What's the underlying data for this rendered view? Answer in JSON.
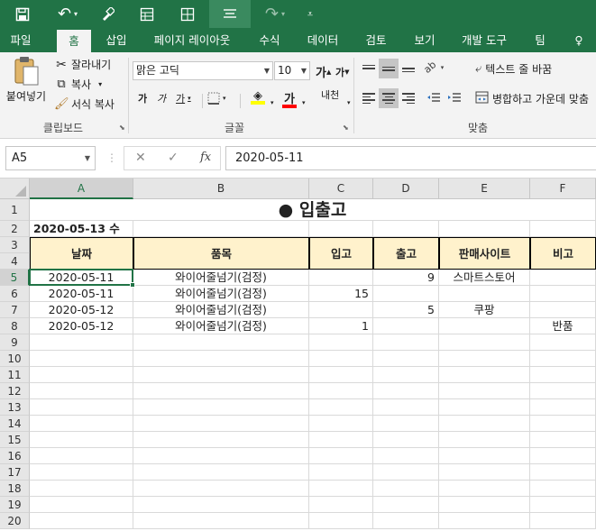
{
  "qat": {
    "save_icon": "save-icon",
    "undo_icon": "undo-icon",
    "brush_icon": "format-painter-icon",
    "form_icon": "form-icon",
    "table_icon": "borders-icon",
    "align_icon": "align-icon",
    "redo_icon": "redo-icon",
    "customize_icon": "customize-qat-icon",
    "undo_glyph": "↶",
    "redo_glyph": "↷",
    "dropdown_glyph": "▾",
    "customize_glyph": "⩡"
  },
  "tabs": [
    "파일",
    "홈",
    "삽입",
    "페이지 레이아웃",
    "수식",
    "데이터",
    "검토",
    "보기",
    "개발 도구",
    "팀"
  ],
  "tell_me_glyph": "♀",
  "ribbon": {
    "clipboard": {
      "paste_label": "붙여넣기",
      "cut_label": "잘라내기",
      "copy_label": "복사",
      "format_painter_label": "서식 복사",
      "group_label": "클립보드"
    },
    "font": {
      "font_name": "맑은 고딕",
      "font_size": "10",
      "grow_label": "가",
      "shrink_label": "가",
      "bold_label": "가",
      "italic_label": "가",
      "underline_label": "가",
      "font_color_label": "가",
      "phonetic_label": "내천",
      "group_label": "글꼴"
    },
    "alignment": {
      "wrap_text_label": "텍스트 줄 바꿈",
      "merge_center_label": "병합하고 가운데 맞춤",
      "group_label": "맞춤",
      "orientation_glyph": "ab"
    }
  },
  "formula_bar": {
    "name_box": "A5",
    "cancel_glyph": "✕",
    "enter_glyph": "✓",
    "fx_label": "fx",
    "value": "2020-05-11"
  },
  "sheet": {
    "columns": [
      "A",
      "B",
      "C",
      "D",
      "E",
      "F"
    ],
    "rows": [
      "1",
      "2",
      "3",
      "4",
      "5",
      "6",
      "7",
      "8",
      "9",
      "10",
      "11",
      "12",
      "13",
      "14",
      "15",
      "16",
      "17",
      "18",
      "19",
      "20"
    ],
    "title": "● 입출고",
    "date_label": "2020-05-13 수",
    "headers": [
      "날짜",
      "품목",
      "입고",
      "출고",
      "판매사이트",
      "비고"
    ],
    "data": [
      [
        "2020-05-11",
        "와이어줄넘기(검정)",
        "",
        "9",
        "스마트스토어",
        ""
      ],
      [
        "2020-05-11",
        "와이어줄넘기(검정)",
        "15",
        "",
        "",
        ""
      ],
      [
        "2020-05-12",
        "와이어줄넘기(검정)",
        "",
        "5",
        "쿠팡",
        ""
      ],
      [
        "2020-05-12",
        "와이어줄넘기(검정)",
        "1",
        "",
        "",
        "반품"
      ]
    ]
  },
  "colors": {
    "accent": "#217346",
    "header_fill": "#fff2cc"
  }
}
